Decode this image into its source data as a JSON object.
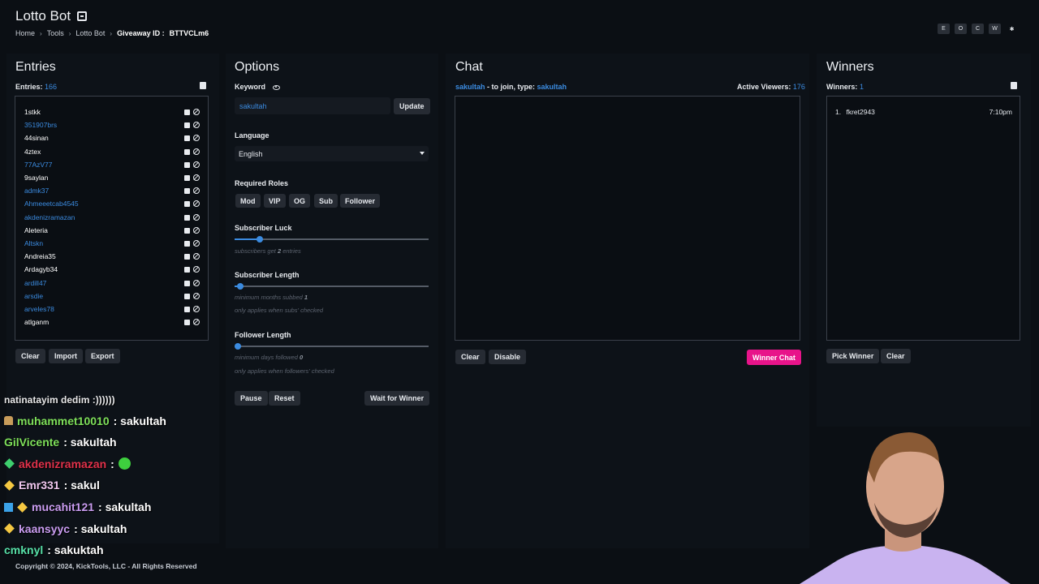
{
  "header": {
    "title": "Lotto Bot",
    "breadcrumb": [
      "Home",
      "Tools",
      "Lotto Bot"
    ],
    "giveaway_label": "Giveaway ID :",
    "giveaway_id": "BTTVCLm6",
    "top_buttons": [
      "E",
      "O",
      "C",
      "W",
      "✱"
    ]
  },
  "entries": {
    "title": "Entries",
    "count_label": "Entries:",
    "count": "166",
    "list": [
      {
        "name": "1stkk",
        "color": "#ffffff"
      },
      {
        "name": "351907brs",
        "color": "#3b8be0"
      },
      {
        "name": "44sinan",
        "color": "#ffffff"
      },
      {
        "name": "4ztex",
        "color": "#ffffff"
      },
      {
        "name": "77AzV77",
        "color": "#3b8be0"
      },
      {
        "name": "9saylan",
        "color": "#ffffff"
      },
      {
        "name": "admk37",
        "color": "#3b8be0"
      },
      {
        "name": "Ahmeeetcab4545",
        "color": "#3b8be0"
      },
      {
        "name": "akdenizramazan",
        "color": "#3b8be0"
      },
      {
        "name": "Aleteria",
        "color": "#ffffff"
      },
      {
        "name": "Altskn",
        "color": "#3b8be0"
      },
      {
        "name": "Andreia35",
        "color": "#ffffff"
      },
      {
        "name": "Ardagyb34",
        "color": "#ffffff"
      },
      {
        "name": "ardill47",
        "color": "#3b8be0"
      },
      {
        "name": "arsdie",
        "color": "#3b8be0"
      },
      {
        "name": "arveles78",
        "color": "#3b8be0"
      },
      {
        "name": "atlganm",
        "color": "#ffffff"
      }
    ],
    "buttons": {
      "clear": "Clear",
      "import": "Import",
      "export": "Export"
    }
  },
  "options": {
    "title": "Options",
    "keyword_label": "Keyword",
    "keyword_value": "sakultah",
    "update_label": "Update",
    "language_label": "Language",
    "language_value": "English",
    "roles_label": "Required Roles",
    "roles": [
      "Mod",
      "VIP",
      "OG",
      "Sub",
      "Follower"
    ],
    "sub_luck_label": "Subscriber Luck",
    "sub_luck_hint_pre": "subscribers get",
    "sub_luck_value": "2",
    "sub_luck_hint_post": "entries",
    "sub_luck_level": 0.13,
    "sub_length_label": "Subscriber Length",
    "sub_length_hint_pre": "minimum months subbed",
    "sub_length_value": "1",
    "sub_length_note": "only applies when subs' checked",
    "sub_length_level": 0.03,
    "follower_length_label": "Follower Length",
    "follower_length_hint_pre": "minimum days followed",
    "follower_length_value": "0",
    "follower_length_note": "only applies when followers' checked",
    "follower_length_level": 0,
    "buttons": {
      "pause": "Pause",
      "reset": "Reset",
      "wait": "Wait for Winner"
    }
  },
  "chat": {
    "title": "Chat",
    "keyword": "sakultah",
    "join_text": " - to join, type: ",
    "viewers_label": "Active Viewers:",
    "viewers": "176",
    "buttons": {
      "clear": "Clear",
      "disable": "Disable",
      "winner_chat": "Winner Chat"
    }
  },
  "winners": {
    "title": "Winners",
    "count_label": "Winners:",
    "count": "1",
    "list": [
      {
        "rank": "1.",
        "name": "fkret2943",
        "time": "7:10pm"
      }
    ],
    "buttons": {
      "pick": "Pick Winner",
      "clear": "Clear"
    }
  },
  "overlay_chat": [
    {
      "user": "natinatayim dedim :))))))",
      "msg": "",
      "color": "#ffffff",
      "badges": []
    },
    {
      "user": "muhammet10010",
      "msg": " : sakultah",
      "color": "#7ee05a",
      "badges": [
        "hat"
      ]
    },
    {
      "user": "GilVicente",
      "msg": " : sakultah",
      "color": "#7ee05a",
      "badges": []
    },
    {
      "user": "akdenizramazan",
      "msg": " : ",
      "color": "#e0314a",
      "badges": [
        "green-diamond"
      ]
    },
    {
      "user": "Emr331",
      "msg": " : sakul",
      "color": "#f0c7ee",
      "badges": [
        "gold-diamond"
      ]
    },
    {
      "user": "mucahit121",
      "msg": " : sakultah",
      "color": "#c99cf0",
      "badges": [
        "blue-cube",
        "gold-diamond"
      ]
    },
    {
      "user": "kaansyyc",
      "msg": " : sakultah",
      "color": "#c99cf0",
      "badges": [
        "gold-diamond"
      ]
    },
    {
      "user": "cmknyl",
      "msg": " : sakuktah",
      "color": "#57e0a8",
      "badges": []
    }
  ],
  "footer": "Copyright © 2024, KickTools, LLC - All Rights Reserved"
}
